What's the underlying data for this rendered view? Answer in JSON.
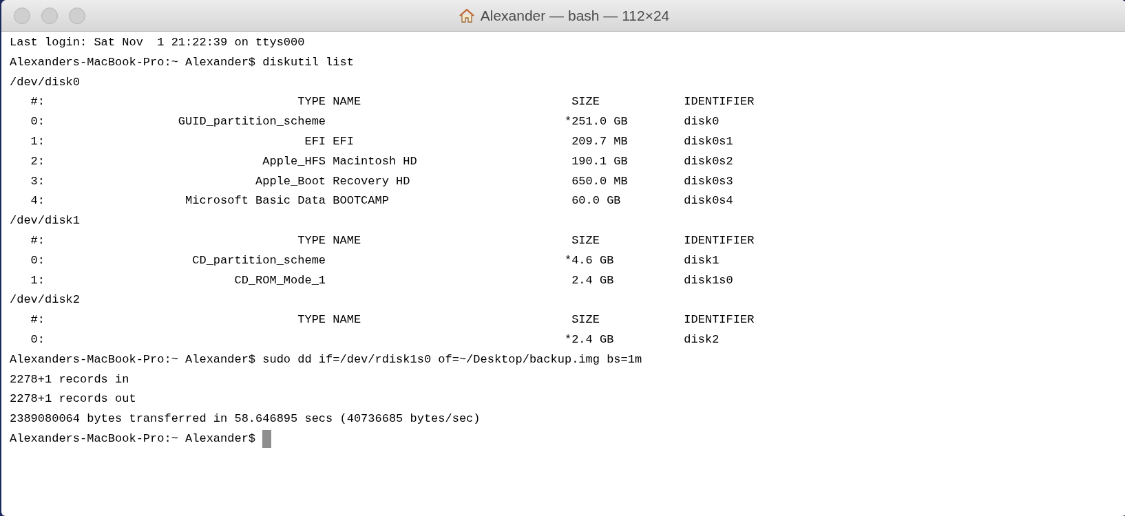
{
  "window": {
    "title": "Alexander — bash — 112×24"
  },
  "terminal": [
    {
      "kind": "text",
      "text": "Last login: Sat Nov  1 21:22:39 on ttys000"
    },
    {
      "kind": "command",
      "prompt": "Alexanders-MacBook-Pro:~ Alexander$",
      "command": "diskutil list"
    },
    {
      "kind": "disk",
      "device": "/dev/disk0",
      "header": {
        "index": "#:",
        "type": "TYPE",
        "name": "NAME",
        "size": "SIZE",
        "identifier": "IDENTIFIER"
      },
      "rows": [
        {
          "index": "0:",
          "type": "GUID_partition_scheme",
          "flag": "*",
          "size": "251.0 GB",
          "identifier": "disk0"
        },
        {
          "index": "1:",
          "type": "EFI",
          "name": "EFI",
          "size": "209.7 MB",
          "identifier": "disk0s1"
        },
        {
          "index": "2:",
          "type": "Apple_HFS",
          "name": "Macintosh HD",
          "size": "190.1 GB",
          "identifier": "disk0s2"
        },
        {
          "index": "3:",
          "type": "Apple_Boot",
          "name": "Recovery HD",
          "size": "650.0 MB",
          "identifier": "disk0s3"
        },
        {
          "index": "4:",
          "type": "Microsoft Basic Data",
          "name": "BOOTCAMP",
          "size": "60.0 GB",
          "identifier": "disk0s4"
        }
      ]
    },
    {
      "kind": "disk",
      "device": "/dev/disk1",
      "header": {
        "index": "#:",
        "type": "TYPE",
        "name": "NAME",
        "size": "SIZE",
        "identifier": "IDENTIFIER"
      },
      "rows": [
        {
          "index": "0:",
          "type": "CD_partition_scheme",
          "flag": "*",
          "size": "4.6 GB",
          "identifier": "disk1"
        },
        {
          "index": "1:",
          "type": "CD_ROM_Mode_1",
          "size": "2.4 GB",
          "identifier": "disk1s0"
        }
      ]
    },
    {
      "kind": "disk",
      "device": "/dev/disk2",
      "header": {
        "index": "#:",
        "type": "TYPE",
        "name": "NAME",
        "size": "SIZE",
        "identifier": "IDENTIFIER"
      },
      "rows": [
        {
          "index": "0:",
          "flag": "*",
          "size": "2.4 GB",
          "identifier": "disk2"
        }
      ]
    },
    {
      "kind": "command",
      "prompt": "Alexanders-MacBook-Pro:~ Alexander$",
      "command": "sudo dd if=/dev/rdisk1s0 of=~/Desktop/backup.img bs=1m"
    },
    {
      "kind": "text",
      "text": "2278+1 records in"
    },
    {
      "kind": "text",
      "text": "2278+1 records out"
    },
    {
      "kind": "text",
      "text": "2389080064 bytes transferred in 58.646895 secs (40736685 bytes/sec)"
    },
    {
      "kind": "input",
      "prompt": "Alexanders-MacBook-Pro:~ Alexander$",
      "cursor": true
    }
  ]
}
